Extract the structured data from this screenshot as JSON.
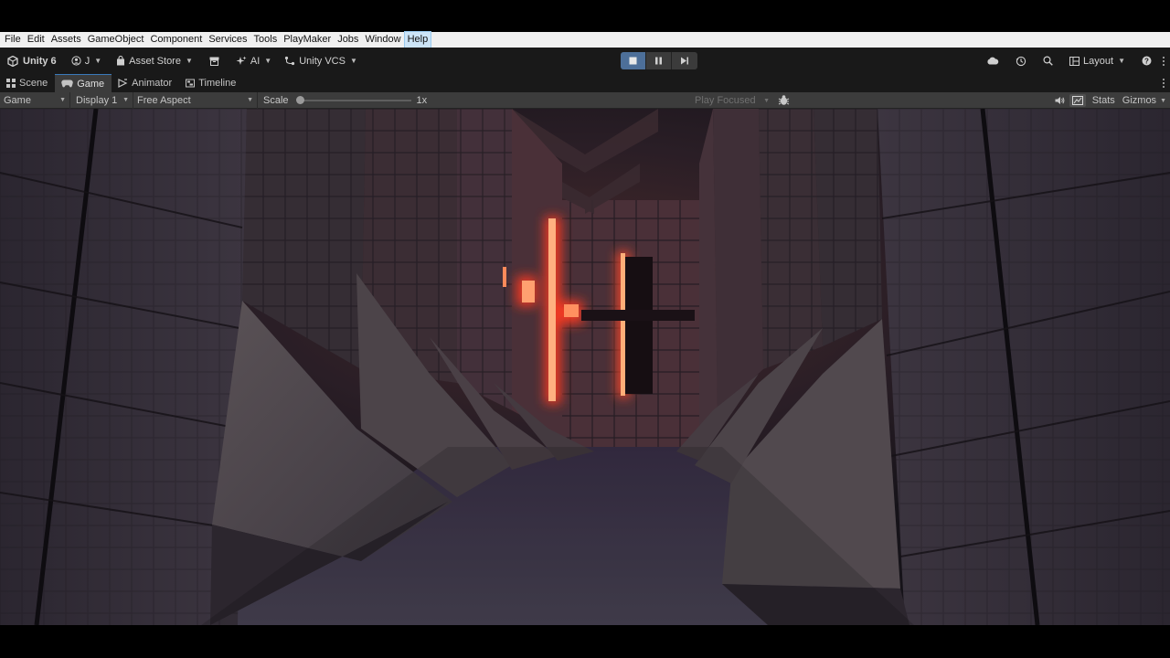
{
  "menu": [
    "File",
    "Edit",
    "Assets",
    "GameObject",
    "Component",
    "Services",
    "Tools",
    "PlayMaker",
    "Jobs",
    "Window",
    "Help"
  ],
  "menu_active": "Help",
  "toolbar": {
    "product": "Unity 6",
    "account": "J",
    "asset_store": "Asset Store",
    "ai": "AI",
    "vcs": "Unity VCS",
    "layout": "Layout"
  },
  "tabs": [
    {
      "label": "Scene",
      "icon": "grid-icon"
    },
    {
      "label": "Game",
      "icon": "gamepad-icon",
      "active": true
    },
    {
      "label": "Animator",
      "icon": "animator-icon"
    },
    {
      "label": "Timeline",
      "icon": "timeline-icon"
    }
  ],
  "gamebar": {
    "view": "Game",
    "display": "Display 1",
    "aspect": "Free Aspect",
    "scale_label": "Scale",
    "scale_value": "1x",
    "play_focused": "Play Focused",
    "stats": "Stats",
    "gizmos": "Gizmos"
  },
  "colors": {
    "accent": "#4d6f99",
    "glow": "#ff4a2a",
    "menu_bg": "#f0f0f0",
    "toolbar_bg": "#191919"
  }
}
